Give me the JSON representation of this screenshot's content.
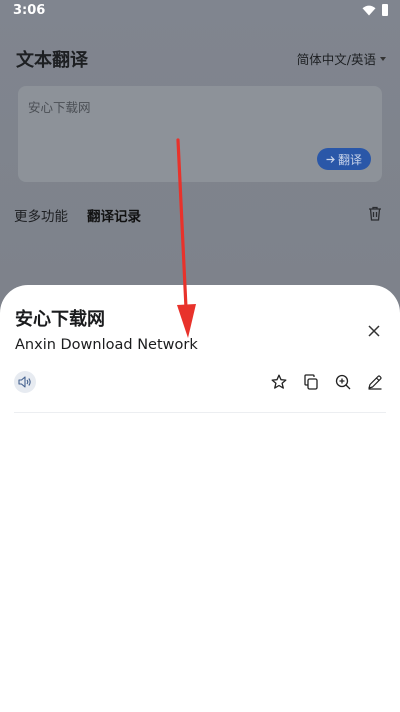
{
  "status": {
    "time": "3:06"
  },
  "app": {
    "title": "文本翻译",
    "language_pair": "简体中文/英语",
    "input": {
      "text": "安心下载网"
    },
    "translate_button": "翻译",
    "more_features": "更多功能",
    "history_tab": "翻译记录"
  },
  "sheet": {
    "source_text": "安心下载网",
    "translation": "Anxin Download Network",
    "icons": [
      "speaker-icon",
      "star-icon",
      "copy-icon",
      "zoom-in-icon",
      "edit-icon",
      "close-icon"
    ]
  },
  "colors": {
    "accent": "#2a57a8",
    "annotation_arrow": "#e8322b"
  }
}
